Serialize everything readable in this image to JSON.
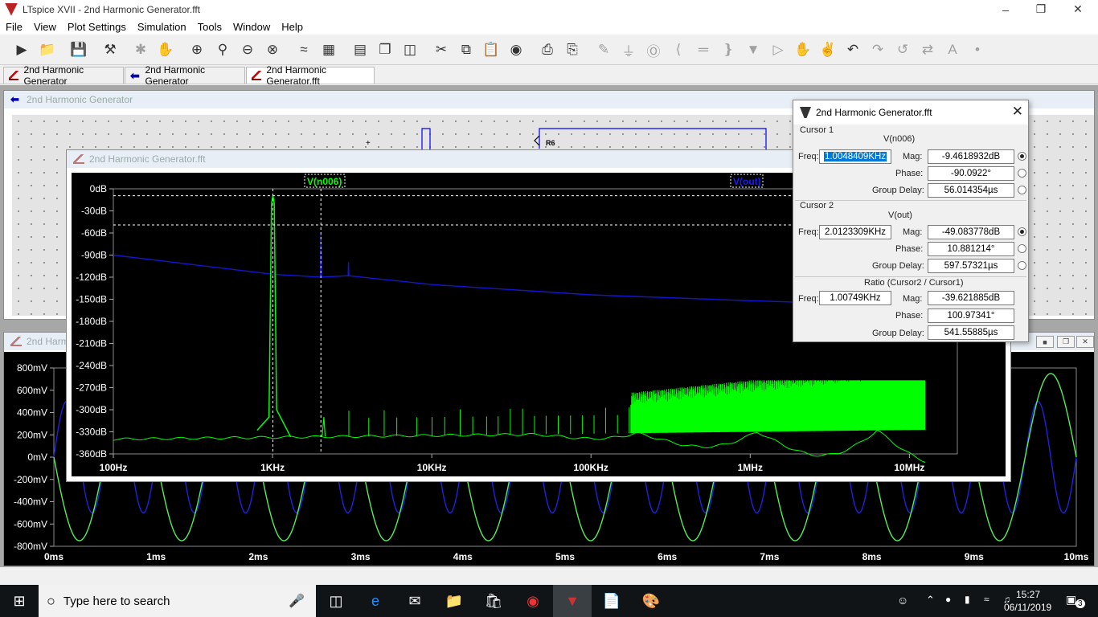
{
  "window": {
    "title": "LTspice XVII - 2nd Harmonic Generator.fft"
  },
  "menu": [
    "File",
    "View",
    "Plot Settings",
    "Simulation",
    "Tools",
    "Window",
    "Help"
  ],
  "tabs": [
    {
      "label": "2nd Harmonic Generator",
      "icon": "waveform-icon"
    },
    {
      "label": "2nd Harmonic Generator",
      "icon": "schematic-icon"
    },
    {
      "label": "2nd Harmonic Generator.fft",
      "icon": "waveform-icon"
    }
  ],
  "schematic": {
    "title": "2nd Harmonic Generator",
    "labels": [
      "R6",
      "+"
    ]
  },
  "transient": {
    "title": "2nd Harm",
    "y_ticks": [
      "800mV",
      "600mV",
      "400mV",
      "200mV",
      "0mV",
      "-200mV",
      "-400mV",
      "-600mV",
      "-800mV"
    ],
    "x_ticks": [
      "0ms",
      "1ms",
      "2ms",
      "3ms",
      "4ms",
      "5ms",
      "6ms",
      "7ms",
      "8ms",
      "9ms",
      "10ms"
    ]
  },
  "fft": {
    "title": "2nd Harmonic Generator.fft",
    "traces": [
      {
        "name": "V(n006)",
        "color": "#00ff00"
      },
      {
        "name": "V(out)",
        "color": "#0000ff"
      }
    ],
    "y_ticks": [
      "0dB",
      "-30dB",
      "-60dB",
      "-90dB",
      "-120dB",
      "-150dB",
      "-180dB",
      "-210dB",
      "-240dB",
      "-270dB",
      "-300dB",
      "-330dB",
      "-360dB"
    ],
    "x_ticks": [
      "100Hz",
      "1KHz",
      "10KHz",
      "100KHz",
      "1MHz",
      "10MHz"
    ]
  },
  "chart_data": [
    {
      "type": "line",
      "title": "2nd Harmonic Generator.fft",
      "xscale": "log",
      "xlim": [
        100,
        20000000
      ],
      "ylim": [
        -360,
        0
      ],
      "x_ticks": [
        "100Hz",
        "1KHz",
        "10KHz",
        "100KHz",
        "1MHz",
        "10MHz"
      ],
      "y_ticks": [
        "0dB",
        "-30dB",
        "-60dB",
        "-90dB",
        "-120dB",
        "-150dB",
        "-180dB",
        "-210dB",
        "-240dB",
        "-270dB",
        "-300dB",
        "-330dB",
        "-360dB"
      ],
      "series": [
        {
          "name": "V(out)",
          "x": [
            100,
            1000,
            2000,
            3000,
            10000,
            100000,
            1000000,
            2000000
          ],
          "y": [
            -90,
            -116,
            -120,
            -118,
            -130,
            -144,
            -152,
            -154
          ]
        },
        {
          "name": "V(n006)",
          "x": [
            100,
            500,
            800,
            950,
            1004.8,
            1060,
            1300,
            2012,
            2100,
            3000,
            10000,
            100000,
            1000000,
            10000000,
            13000000
          ],
          "y": [
            -340,
            -336,
            -328,
            -310,
            -9.46,
            -300,
            -337,
            -49.08,
            -335,
            -338,
            -336,
            -330,
            -320,
            -300,
            -330
          ]
        }
      ]
    },
    {
      "type": "line",
      "title": "2nd Harm",
      "xlim": [
        0,
        10
      ],
      "ylim": [
        -800,
        800
      ],
      "x_ticks": [
        "0ms",
        "1ms",
        "2ms",
        "3ms",
        "4ms",
        "5ms",
        "6ms",
        "7ms",
        "8ms",
        "9ms",
        "10ms"
      ],
      "y_ticks": [
        "800mV",
        "600mV",
        "400mV",
        "200mV",
        "0mV",
        "-200mV",
        "-400mV",
        "-600mV",
        "-800mV"
      ],
      "series": [
        {
          "name": "V(n006)",
          "amplitude_mV": 750,
          "freq_kHz": 1
        },
        {
          "name": "V(out)",
          "amplitude_mV": 500,
          "freq_kHz": 2
        }
      ]
    }
  ],
  "cursors": {
    "title": "2nd Harmonic Generator.fft",
    "cursor1": {
      "label": "Cursor 1",
      "trace": "V(n006)",
      "freq_label": "Freq:",
      "freq": "1.0048409KHz",
      "mag_label": "Mag:",
      "mag": "-9.4618932dB",
      "phase_label": "Phase:",
      "phase": "-90.0922°",
      "gd_label": "Group Delay:",
      "gd": "56.014354µs"
    },
    "cursor2": {
      "label": "Cursor 2",
      "trace": "V(out)",
      "freq_label": "Freq:",
      "freq": "2.0123309KHz",
      "mag_label": "Mag:",
      "mag": "-49.083778dB",
      "phase_label": "Phase:",
      "phase": "10.881214°",
      "gd_label": "Group Delay:",
      "gd": "597.57321µs"
    },
    "ratio": {
      "label": "Ratio (Cursor2 / Cursor1)",
      "freq_label": "Freq:",
      "freq": "1.00749KHz",
      "mag_label": "Mag:",
      "mag": "-39.621885dB",
      "phase_label": "Phase:",
      "phase": "100.97341°",
      "gd_label": "Group Delay:",
      "gd": "541.55885µs"
    }
  },
  "taskbar": {
    "search_placeholder": "Type here to search",
    "time": "15:27",
    "date": "06/11/2019",
    "notifications": "3"
  }
}
